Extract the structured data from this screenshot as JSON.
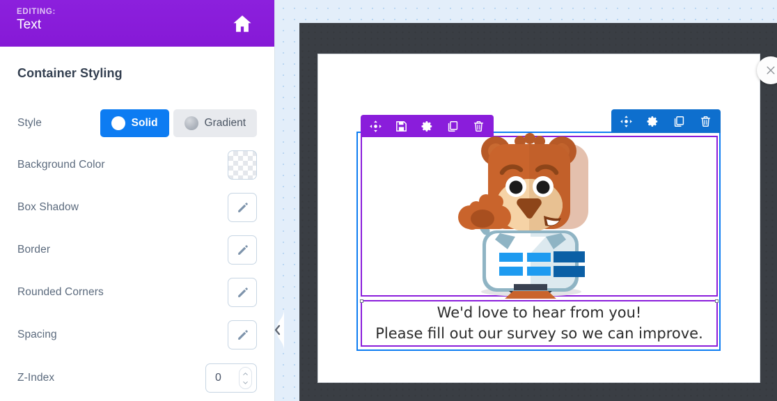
{
  "sidebar": {
    "header": {
      "editing_label": "EDITING:",
      "editing_value": "Text",
      "home_icon": "home-icon"
    },
    "panel_title": "Container Styling",
    "rows": [
      {
        "label": "Style",
        "control": "segmented",
        "options": [
          {
            "label": "Solid",
            "selected": true,
            "icon": "solid-circle-icon"
          },
          {
            "label": "Gradient",
            "selected": false,
            "icon": "gradient-circle-icon"
          }
        ]
      },
      {
        "label": "Background Color",
        "control": "color-swatch",
        "value": "transparent"
      },
      {
        "label": "Box Shadow",
        "control": "edit-button",
        "icon": "pencil-icon"
      },
      {
        "label": "Border",
        "control": "edit-button",
        "icon": "pencil-icon"
      },
      {
        "label": "Rounded Corners",
        "control": "edit-button",
        "icon": "pencil-icon"
      },
      {
        "label": "Spacing",
        "control": "edit-button",
        "icon": "pencil-icon"
      },
      {
        "label": "Z-Index",
        "control": "number-stepper",
        "value": "0"
      }
    ],
    "collapse_handle_icon": "chevron-left-icon"
  },
  "canvas": {
    "close_icon": "close-x-icon",
    "outer_toolbar": [
      {
        "icon": "move-icon",
        "name": "move-handle"
      },
      {
        "icon": "gear-icon",
        "name": "settings-button"
      },
      {
        "icon": "copy-icon",
        "name": "duplicate-button"
      },
      {
        "icon": "trash-icon",
        "name": "delete-button"
      }
    ],
    "inner_toolbar": [
      {
        "icon": "move-icon",
        "name": "move-handle"
      },
      {
        "icon": "save-icon",
        "name": "save-button"
      },
      {
        "icon": "gear-icon",
        "name": "settings-button"
      },
      {
        "icon": "copy-icon",
        "name": "duplicate-button"
      },
      {
        "icon": "trash-icon",
        "name": "delete-button"
      }
    ],
    "image_alt": "waving-bear-mascot-holding-survey",
    "text_block": {
      "line1": "We'd love to hear from you!",
      "line2": "Please fill out our survey so we can improve."
    }
  },
  "colors": {
    "editing_purple": "#8a1ddb",
    "accent_blue": "#0d7cf2",
    "toolbar_blue": "#0e6fce",
    "frame_dark": "#3a3e44",
    "canvas_bg": "#e3eefa"
  }
}
